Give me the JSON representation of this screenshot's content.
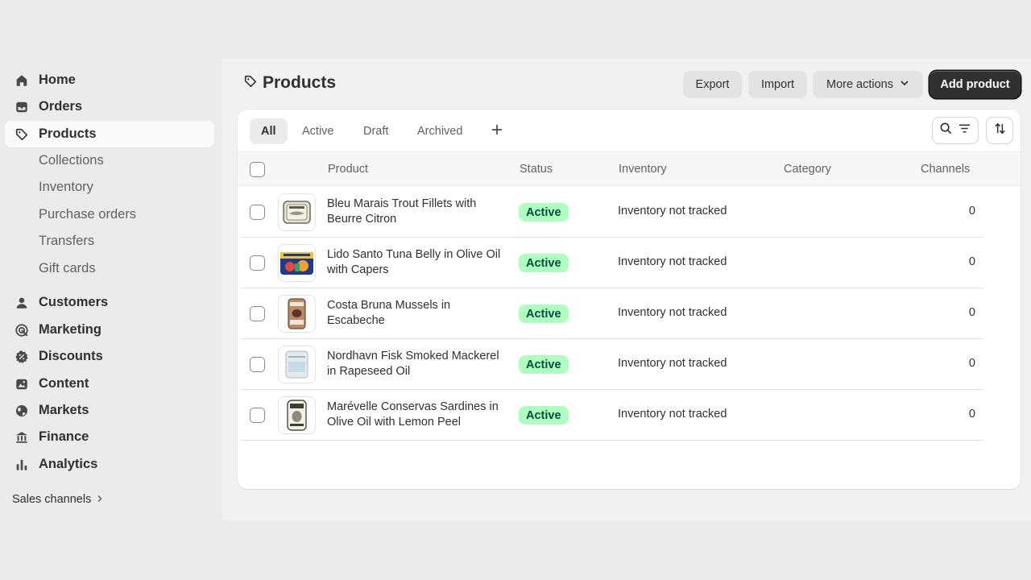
{
  "sidebar": {
    "items": [
      {
        "label": "Home",
        "icon": "home-icon"
      },
      {
        "label": "Orders",
        "icon": "inbox-icon"
      },
      {
        "label": "Products",
        "icon": "tag-icon"
      },
      {
        "label": "Customers",
        "icon": "person-icon"
      },
      {
        "label": "Marketing",
        "icon": "target-icon"
      },
      {
        "label": "Discounts",
        "icon": "discount-icon"
      },
      {
        "label": "Content",
        "icon": "content-icon"
      },
      {
        "label": "Markets",
        "icon": "globe-icon"
      },
      {
        "label": "Finance",
        "icon": "bank-icon"
      },
      {
        "label": "Analytics",
        "icon": "bar-chart-icon"
      }
    ],
    "sub_items": [
      "Collections",
      "Inventory",
      "Purchase orders",
      "Transfers",
      "Gift cards"
    ],
    "sales_channels": "Sales channels"
  },
  "header": {
    "title": "Products",
    "export": "Export",
    "import": "Import",
    "more_actions": "More actions",
    "add_product": "Add product"
  },
  "tabs": [
    "All",
    "Active",
    "Draft",
    "Archived"
  ],
  "table": {
    "columns": [
      "Product",
      "Status",
      "Inventory",
      "Category",
      "Channels"
    ],
    "rows": [
      {
        "line1": "Bleu Marais Trout Fillets with",
        "line2": "Beurre Citron",
        "status": "Active",
        "inventory": "Inventory not tracked",
        "category": "",
        "channels": "0"
      },
      {
        "line1": "Lido Santo Tuna Belly in Olive Oil",
        "line2": "with Capers",
        "status": "Active",
        "inventory": "Inventory not tracked",
        "category": "",
        "channels": "0"
      },
      {
        "line1": "Costa Bruna Mussels in",
        "line2": "Escabeche",
        "status": "Active",
        "inventory": "Inventory not tracked",
        "category": "",
        "channels": "0"
      },
      {
        "line1": "Nordhavn Fisk Smoked Mackerel",
        "line2": "in Rapeseed Oil",
        "status": "Active",
        "inventory": "Inventory not tracked",
        "category": "",
        "channels": "0"
      },
      {
        "line1": "Marévelle Conservas Sardines in",
        "line2": "Olive Oil with Lemon Peel",
        "status": "Active",
        "inventory": "Inventory not tracked",
        "category": "",
        "channels": "0"
      }
    ]
  },
  "colors": {
    "primary_button": "#303030",
    "active_badge_bg": "#affebf",
    "active_badge_text": "#014b40",
    "sidebar_bg": "#ebebeb",
    "page_bg": "#f1f1f1"
  }
}
